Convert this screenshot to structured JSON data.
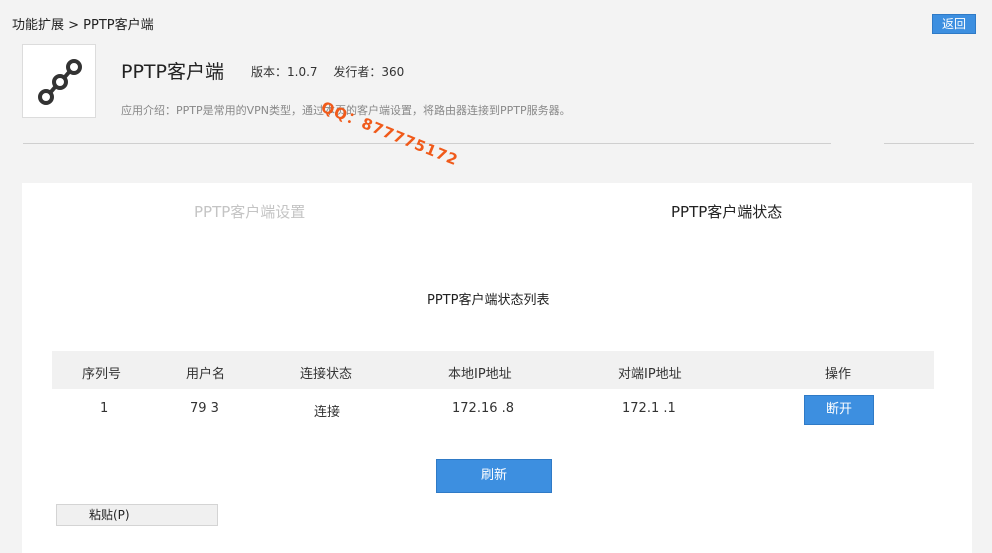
{
  "header": {
    "breadcrumb": "功能扩展 > PPTP客户端",
    "back_label": "返回"
  },
  "app": {
    "icon": "chain-link-icon",
    "title": "PPTP客户端",
    "version": "版本：1.0.7",
    "publisher": "发行者：360",
    "description": "应用介绍：PPTP是常用的VPN类型，通过本页的客户端设置，将路由器连接到PPTP服务器。"
  },
  "watermark": "QQ：877775172",
  "tabs": [
    {
      "label": "PPTP客户端设置",
      "active": false
    },
    {
      "label": "PPTP客户端状态",
      "active": true
    }
  ],
  "status_list": {
    "title": "PPTP客户端状态列表",
    "columns": [
      "序列号",
      "用户名",
      "连接状态",
      "本地IP地址",
      "对端IP地址",
      "操作"
    ],
    "rows": [
      {
        "index": "1",
        "username": "79  3",
        "status": "连接",
        "local_ip": "172.16  .8",
        "peer_ip": "172.1    .1",
        "action_label": "断开"
      }
    ]
  },
  "refresh_label": "刷新",
  "context_menu": {
    "paste_label": "粘贴(P)"
  },
  "colors": {
    "accent": "#3d8fe0",
    "watermark": "#f05a1a",
    "background": "#f3f3f3"
  }
}
